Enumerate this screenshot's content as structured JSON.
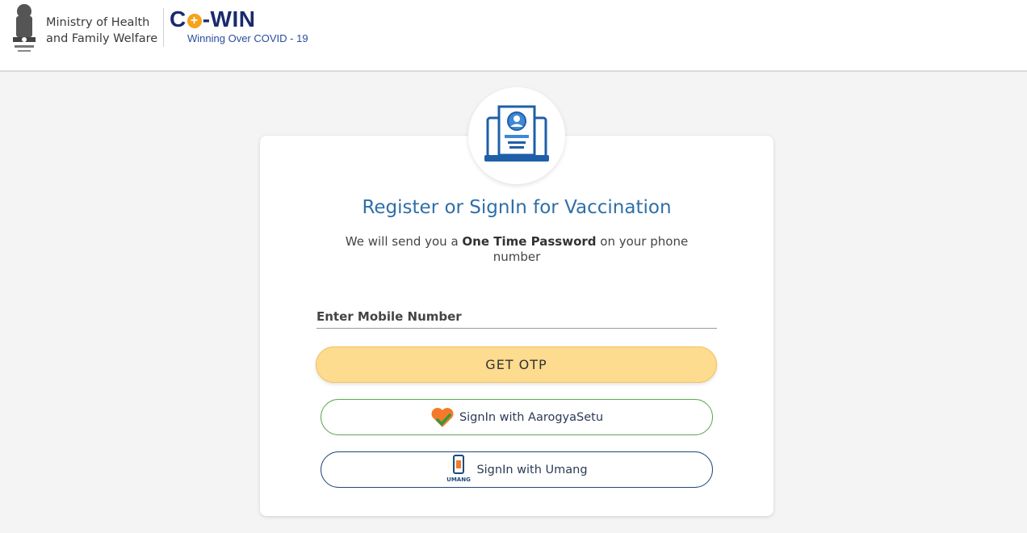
{
  "header": {
    "ministry_line1": "Ministry of Health",
    "ministry_line2": "and Family Welfare",
    "logo_text_co": "C",
    "logo_plus": "+",
    "logo_text_win": "-WIN",
    "tagline": "Winning Over COVID - 19"
  },
  "card": {
    "title": "Register or SignIn for Vaccination",
    "subtitle_pre": "We will send you a ",
    "subtitle_bold": "One Time Password",
    "subtitle_post": " on your phone number",
    "mobile_placeholder": "Enter Mobile Number",
    "otp_button": "GET OTP",
    "aarogya_button": "SignIn with AarogyaSetu",
    "umang_button": "SignIn with Umang",
    "umang_icon_label": "UMANG"
  },
  "colors": {
    "title": "#2f6fa8",
    "otp_bg": "#fddb8f",
    "aarogya_border": "#5aa84f",
    "umang_border": "#1f4a7a",
    "brand_orange": "#f7a21b"
  },
  "icons": [
    "national-emblem-icon",
    "vaccination-laptop-icon",
    "aarogyasetu-heart-icon",
    "umang-phone-icon"
  ]
}
